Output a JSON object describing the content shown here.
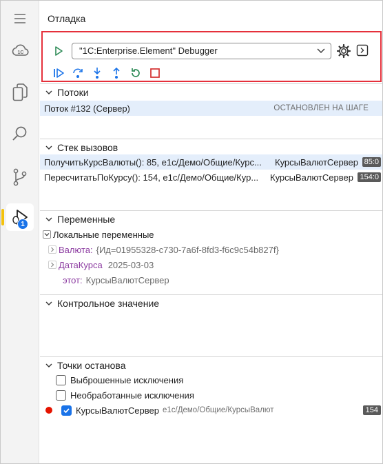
{
  "panel": {
    "title": "Отладка"
  },
  "launch": {
    "config": "\"1C:Enterprise.Element\" Debugger"
  },
  "activity": {
    "items": [
      "menu-icon",
      "cloud-icon",
      "files-icon",
      "search-icon",
      "source-control-icon",
      "run-debug-icon"
    ],
    "debug_badge": "1"
  },
  "threads": {
    "title": "Потоки",
    "items": [
      {
        "name": "Поток #132 (Сервер)",
        "status": "ОСТАНОВЛЕН НА ШАГЕ"
      }
    ]
  },
  "callstack": {
    "title": "Стек вызовов",
    "frames": [
      {
        "label": "ПолучитьКурсВалюты(): 85, e1c/Демо/Общие/Курс...",
        "module": "КурсыВалютСервер",
        "pos": "85:0"
      },
      {
        "label": "ПересчитатьПоКурсу(): 154, e1c/Демо/Общие/Кур...",
        "module": "КурсыВалютСервер",
        "pos": "154:0"
      }
    ]
  },
  "variables": {
    "title": "Переменные",
    "scope": "Локальные переменные",
    "items": [
      {
        "name": "Валюта:",
        "value": "{Ид=01955328-c730-7a6f-8fd3-f6c9c54b827f}"
      },
      {
        "name": "ДатаКурса",
        "value": "2025-03-03"
      },
      {
        "name": "этот:",
        "value": "КурсыВалютСервер"
      }
    ]
  },
  "watch": {
    "title": "Контрольное значение"
  },
  "breakpoints": {
    "title": "Точки останова",
    "items": [
      {
        "label": "Выброшенные исключения"
      },
      {
        "label": "Необработанные исключения"
      },
      {
        "label": "КурсыВалютСервер",
        "path": "e1c/Демо/Общие/КурсыВалют",
        "line": "154"
      }
    ]
  },
  "colors": {
    "accent": "#1a73e8",
    "highlight_border": "#e5303b",
    "run_green": "#2e8b57",
    "stop_red": "#d32f2f",
    "variable_name": "#8b3aa0",
    "breakpoint": "#e51400"
  }
}
